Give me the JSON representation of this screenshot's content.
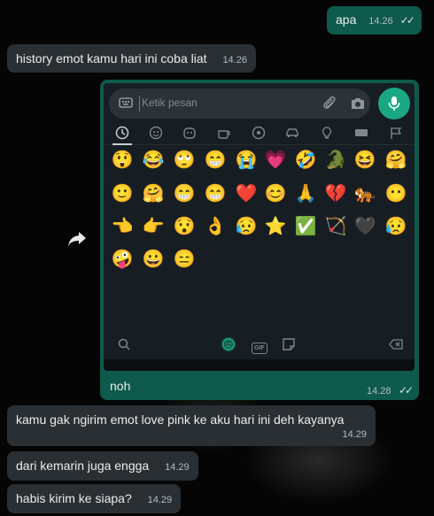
{
  "messages": {
    "m1": {
      "text": "apa",
      "time": "14.26",
      "ticks": "✓✓"
    },
    "m2": {
      "text": "history emot kamu hari ini coba liat",
      "time": "14.26"
    },
    "m3": {
      "caption": "noh",
      "time": "14.28",
      "ticks": "✓✓"
    },
    "m4": {
      "text": "kamu gak ngirim emot love pink ke aku hari ini deh kayanya",
      "time": "14.29"
    },
    "m5": {
      "text": "dari kemarin juga engga",
      "time": "14.29"
    },
    "m6": {
      "text": "habis kirim ke siapa?",
      "time": "14.29"
    }
  },
  "keyboard": {
    "placeholder": "Ketik pesan",
    "icons": {
      "keyboard": "keyboard-icon",
      "attach": "paperclip-icon",
      "camera": "camera-icon",
      "mic": "mic-icon",
      "search": "search-icon",
      "emoji_tab": "emoji-icon",
      "gif_tab": "gif-icon",
      "sticker_tab": "sticker-icon",
      "backspace": "backspace-icon"
    },
    "gif_label": "GIF",
    "categories": [
      "recent-icon",
      "smiley-icon",
      "animal-icon",
      "food-icon",
      "ball-icon",
      "car-icon",
      "bulb-icon",
      "symbols-icon",
      "flag-icon"
    ],
    "emoji_rows": [
      [
        "😲",
        "😂",
        "🙄",
        "😁",
        "😭",
        "💗",
        "🤣",
        "🐊",
        "😆",
        "🤗"
      ],
      [
        "🙂",
        "🤗",
        "😁",
        "😁",
        "❤️",
        "😊",
        "🙏",
        "💔",
        "🐅",
        "😶"
      ],
      [
        "👈",
        "👉",
        "😯",
        "👌",
        "😥",
        "⭐",
        "✅",
        "🏹",
        "🖤",
        "😥"
      ],
      [
        "🤪",
        "😀",
        "😑"
      ]
    ]
  },
  "colors": {
    "accent": "#1aa884",
    "outgoing_bubble": "#0e5a4c",
    "incoming_bubble": "#2a2f33"
  }
}
